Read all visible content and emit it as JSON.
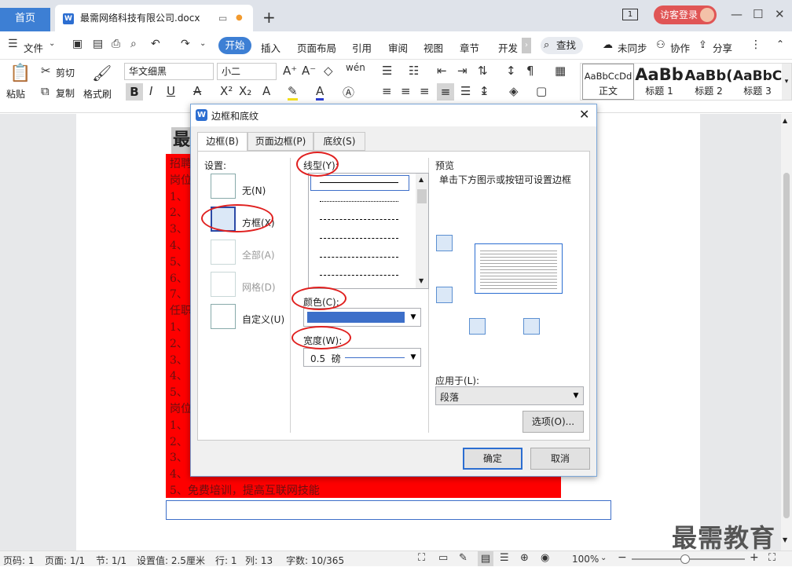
{
  "tabs": {
    "home": "首页",
    "doc_title": "最需网络科技有限公司.docx",
    "add": "+"
  },
  "topright": {
    "page_badge": "1",
    "login": "访客登录"
  },
  "menu": {
    "file": "文件",
    "items": [
      "开始",
      "插入",
      "页面布局",
      "引用",
      "审阅",
      "视图",
      "章节",
      "开发"
    ],
    "search": "查找",
    "sync": "未同步",
    "collab": "协作",
    "share": "分享"
  },
  "toolbar": {
    "paste": "粘贴",
    "cut": "剪切",
    "copy": "复制",
    "format_painter": "格式刷",
    "font_name": "华文细黑",
    "font_size": "小二",
    "styles": [
      {
        "preview": "AaBbCcDd",
        "name": "正文"
      },
      {
        "preview": "AaBb",
        "name": "标题 1"
      },
      {
        "preview": "AaBb(",
        "name": "标题 2"
      },
      {
        "preview": "AaBbC",
        "name": "标题 3"
      }
    ]
  },
  "document": {
    "heading_fragment": "最",
    "lines": [
      "招聘",
      "岗位",
      "1、",
      "2、",
      "3、",
      "4、",
      "5、",
      "6、",
      "7、",
      "任职",
      "1、",
      "2、",
      "3、",
      "4、",
      "5、",
      "岗位",
      "1、",
      "2、",
      "3、",
      "4、"
    ],
    "last_line": "5、免费培训，提高互联网技能"
  },
  "dialog": {
    "title": "边框和底纹",
    "tabs": [
      "边框(B)",
      "页面边框(P)",
      "底纹(S)"
    ],
    "settings_label": "设置:",
    "settings": [
      "无(N)",
      "方框(X)",
      "全部(A)",
      "网格(D)",
      "自定义(U)"
    ],
    "line_style_label": "线型(Y):",
    "color_label": "颜色(C):",
    "color_value": "#3d6fc9",
    "width_label": "宽度(W):",
    "width_value": "0.5  磅",
    "preview_label": "预览",
    "preview_hint": "单击下方图示或按钮可设置边框",
    "apply_label": "应用于(L):",
    "apply_value": "段落",
    "options_button": "选项(O)...",
    "ok_button": "确定",
    "cancel_button": "取消"
  },
  "status": {
    "page_num": "页码: 1",
    "page": "页面: 1/1",
    "section": "节: 1/1",
    "setting": "设置值: 2.5厘米",
    "row": "行: 1",
    "col": "列: 13",
    "words": "字数: 10/365",
    "zoom": "100%"
  },
  "watermark": "最需教育"
}
